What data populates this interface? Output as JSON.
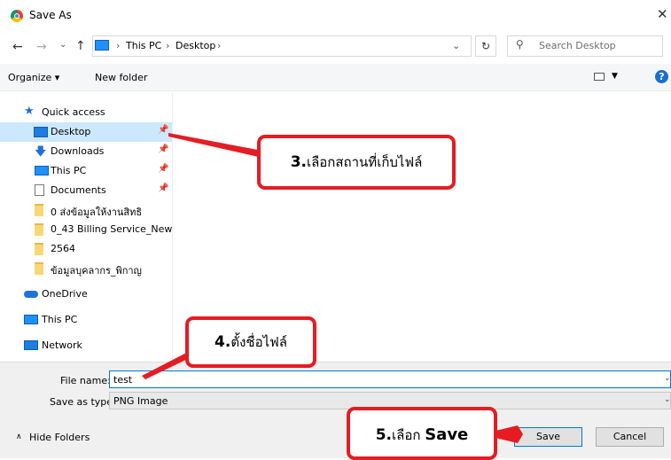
{
  "window": {
    "title": "Save As",
    "close_glyph": "✕"
  },
  "address": {
    "crumbs": [
      "This PC",
      "Desktop"
    ],
    "sep": "›",
    "search_placeholder": "Search Desktop"
  },
  "toolbar": {
    "organize": "Organize ▾",
    "new_folder": "New folder",
    "help": "?"
  },
  "nav": {
    "quick_access": "Quick access",
    "items": [
      {
        "label": "Desktop",
        "icon": "desktop-icon",
        "pinned": true,
        "selected": true
      },
      {
        "label": "Downloads",
        "icon": "downloads-icon",
        "pinned": true
      },
      {
        "label": "This PC",
        "icon": "pc-icon",
        "pinned": true
      },
      {
        "label": "Documents",
        "icon": "documents-icon",
        "pinned": true
      },
      {
        "label": "0 ส่งข้อมูลให้งานสิทธิ",
        "icon": "folder-icon"
      },
      {
        "label": "0_43 Billing Service_New",
        "icon": "folder-icon"
      },
      {
        "label": "2564",
        "icon": "folder-icon"
      },
      {
        "label": "ข้อมูลบุคลากร_พิกาญ",
        "icon": "folder-icon"
      }
    ],
    "onedrive": "OneDrive",
    "this_pc": "This PC",
    "network": "Network"
  },
  "form": {
    "file_name_label": "File name:",
    "file_name_value": "test",
    "save_type_label": "Save as type:",
    "save_type_value": "PNG Image",
    "hide_folders": "Hide Folders",
    "save": "Save",
    "cancel": "Cancel"
  },
  "annotations": {
    "step3_num": "3.",
    "step3_text": "เลือกสถานที่เก็บไฟล์",
    "step4_num": "4.",
    "step4_text": "ตั้งชื่อไฟล์",
    "step5_num": "5.",
    "step5_text": "เลือก ",
    "step5_bold": "Save"
  },
  "colors": {
    "accent": "#0078d7",
    "selected_bg": "#cce8ff",
    "callout_red": "#e51c23"
  }
}
